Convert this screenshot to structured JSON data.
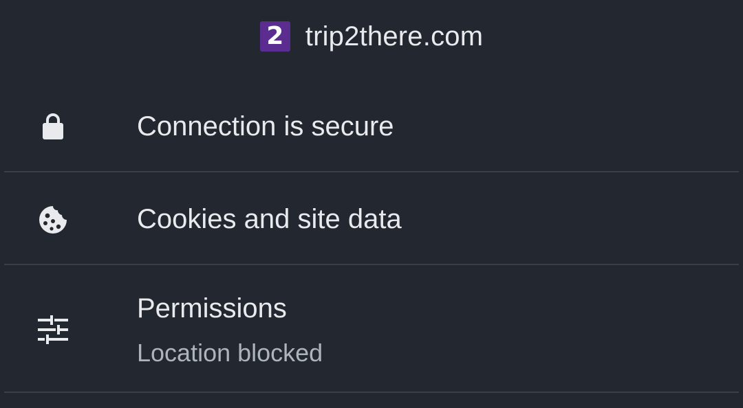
{
  "header": {
    "favicon_glyph": "2",
    "favicon_color": "#5b2d91",
    "site_name": "trip2there.com"
  },
  "rows": [
    {
      "icon": "lock-icon",
      "label": "Connection is secure"
    },
    {
      "icon": "cookie-icon",
      "label": "Cookies and site data"
    },
    {
      "icon": "tune-icon",
      "label": "Permissions",
      "sublabel": "Location blocked"
    }
  ],
  "colors": {
    "background": "#23272f",
    "text": "#e8eaed",
    "secondary_text": "#aeb4bd",
    "divider": "#3b4048"
  }
}
